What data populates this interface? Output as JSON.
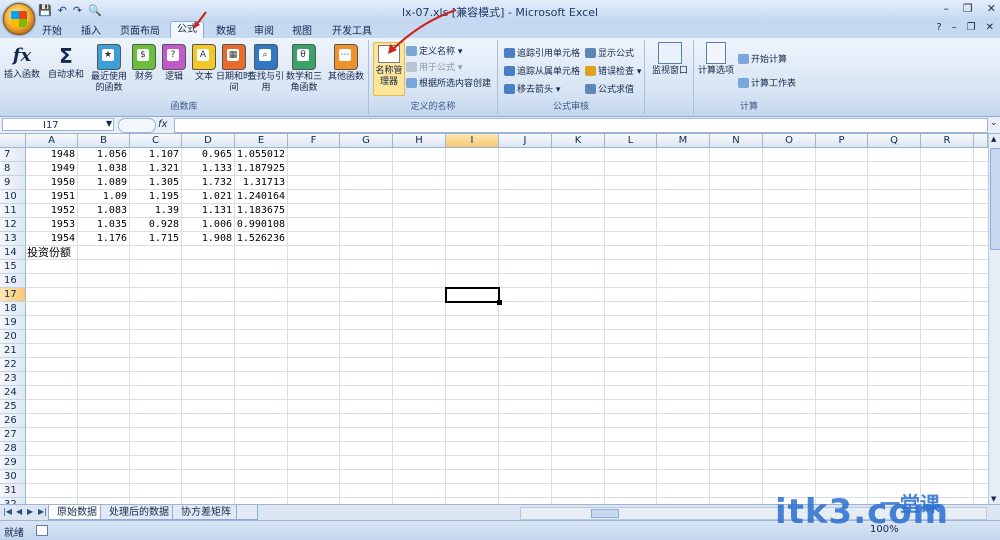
{
  "window": {
    "title": "lx-07.xls  [兼容模式] - Microsoft Excel",
    "help_glyph": "?",
    "minimize": "–",
    "restore": "❐",
    "close": "✕"
  },
  "qat": [
    "💾",
    "↶",
    "↷",
    "🔍"
  ],
  "tabs": [
    "开始",
    "插入",
    "页面布局",
    "公式",
    "数据",
    "审阅",
    "视图",
    "开发工具"
  ],
  "active_tab": "公式",
  "function_library": {
    "group_label": "函数库",
    "buttons": [
      {
        "label": "插入函数",
        "icon": "fx"
      },
      {
        "label": "自动求和",
        "icon": "Σ"
      },
      {
        "label": "最近使用的函数",
        "icon": "book"
      },
      {
        "label": "财务",
        "icon": "book"
      },
      {
        "label": "逻辑",
        "icon": "?"
      },
      {
        "label": "文本",
        "icon": "A"
      },
      {
        "label": "日期和时间",
        "icon": "book"
      },
      {
        "label": "查找与引用",
        "icon": "book"
      },
      {
        "label": "数学和三角函数",
        "icon": "θ"
      },
      {
        "label": "其他函数",
        "icon": "book"
      }
    ]
  },
  "defined_names": {
    "group_label": "定义的名称",
    "name_manager": "名称管理器",
    "define_name": "定义名称 ▾",
    "use_in_formula": "用于公式 ▾",
    "create_from_selection": "根据所选内容创建"
  },
  "formula_auditing": {
    "group_label": "公式审核",
    "trace_precedents": "追踪引用单元格",
    "trace_dependents": "追踪从属单元格",
    "remove_arrows": "移去箭头 ▾",
    "show_formulas": "显示公式",
    "error_checking": "错误检查 ▾",
    "evaluate_formula": "公式求值",
    "watch_window": "监视窗口"
  },
  "calculation": {
    "group_label": "计算",
    "calc_options": "计算选项",
    "calc_now": "开始计算",
    "calc_sheet": "计算工作表"
  },
  "formula_bar": {
    "name_box": "I17",
    "fx": "fx",
    "formula": ""
  },
  "columns": [
    "A",
    "B",
    "C",
    "D",
    "E",
    "F",
    "G",
    "H",
    "I",
    "J",
    "K",
    "L",
    "M",
    "N",
    "O",
    "P",
    "Q",
    "R"
  ],
  "selected_column": "I",
  "rows": [
    "7",
    "8",
    "9",
    "10",
    "11",
    "12",
    "13",
    "14",
    "15",
    "16",
    "17",
    "18",
    "19",
    "20",
    "21",
    "22",
    "23",
    "24",
    "25",
    "26",
    "27",
    "28",
    "29",
    "30",
    "31",
    "32"
  ],
  "selected_row": "17",
  "cells": [
    [
      "1948",
      "1.056",
      "1.107",
      "0.965",
      "1.055012"
    ],
    [
      "1949",
      "1.038",
      "1.321",
      "1.133",
      "1.187925"
    ],
    [
      "1950",
      "1.089",
      "1.305",
      "1.732",
      "1.31713"
    ],
    [
      "1951",
      "1.09",
      "1.195",
      "1.021",
      "1.240164"
    ],
    [
      "1952",
      "1.083",
      "1.39",
      "1.131",
      "1.183675"
    ],
    [
      "1953",
      "1.035",
      "0.928",
      "1.006",
      "0.990108"
    ],
    [
      "1954",
      "1.176",
      "1.715",
      "1.908",
      "1.526236"
    ]
  ],
  "a14_text": "投资份额",
  "sheet_tabs": [
    "原始数据",
    "处理后的数据",
    "协方差矩阵"
  ],
  "active_sheet": "原始数据",
  "status": {
    "ready": "就绪",
    "zoom": "100%"
  },
  "watermark": {
    "site": "itk3",
    "suffix": ".com",
    "cn": "一堂课"
  }
}
